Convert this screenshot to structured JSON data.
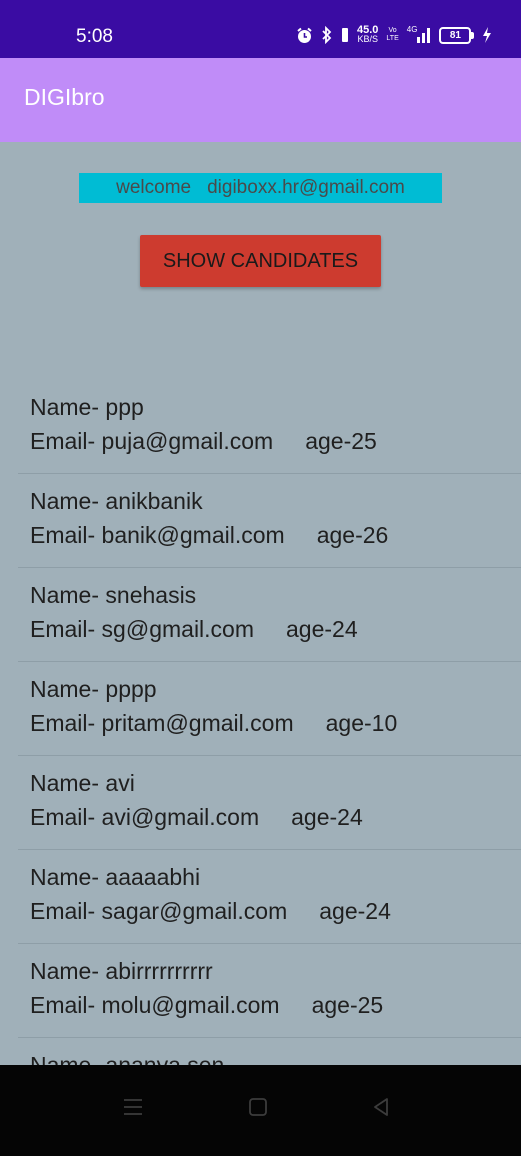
{
  "status_bar": {
    "time": "5:08",
    "speed_value": "45.0",
    "speed_unit": "KB/S",
    "vo_top": "Vo",
    "vo_bottom": "LTE",
    "network": "4G",
    "battery": "81"
  },
  "app_bar": {
    "title": "DIGIbro"
  },
  "welcome": {
    "prefix": "welcome",
    "email": "digiboxx.hr@gmail.com"
  },
  "button": {
    "label": "SHOW CANDIDATES"
  },
  "candidates": [
    {
      "name": "Name- ppp",
      "email": "Email-  puja@gmail.com",
      "age": "age-25"
    },
    {
      "name": "Name- anikbanik",
      "email": "Email-  banik@gmail.com",
      "age": "age-26"
    },
    {
      "name": "Name- snehasis",
      "email": "Email-  sg@gmail.com",
      "age": "age-24"
    },
    {
      "name": "Name- pppp",
      "email": "Email-  pritam@gmail.com",
      "age": "age-10"
    },
    {
      "name": "Name- avi",
      "email": "Email-  avi@gmail.com",
      "age": "age-24"
    },
    {
      "name": "Name- aaaaabhi",
      "email": "Email-  sagar@gmail.com",
      "age": "age-24"
    },
    {
      "name": "Name- abirrrrrrrrrr",
      "email": "Email-  molu@gmail.com",
      "age": "age-25"
    },
    {
      "name": "Name- ananya sen",
      "email": "",
      "age": ""
    }
  ],
  "nav": {
    "icons": [
      "menu-icon",
      "home-icon",
      "back-icon"
    ]
  },
  "colors": {
    "status_bar": "#3a0ca3",
    "app_bar": "#c08cf8",
    "background": "#a0b0b9",
    "welcome_bg": "#00bcd4",
    "button": "#cd3b2f",
    "nav_bar": "#050505"
  }
}
